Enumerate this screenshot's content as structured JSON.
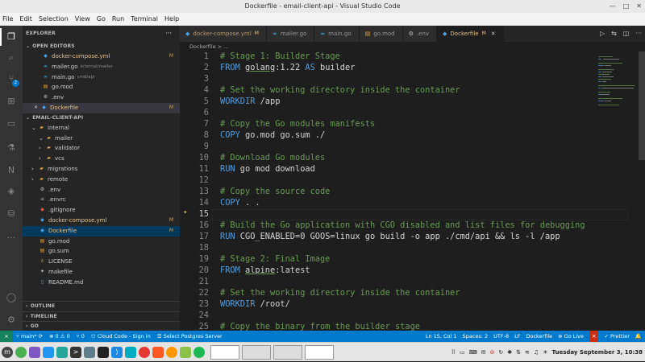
{
  "window": {
    "title": "Dockerfile - email-client-api - Visual Studio Code"
  },
  "menu": [
    "File",
    "Edit",
    "Selection",
    "View",
    "Go",
    "Run",
    "Terminal",
    "Help"
  ],
  "activity": {
    "icons": [
      "files-icon",
      "search-icon",
      "source-control-icon",
      "extensions-icon",
      "remote-explorer-icon",
      "testing-icon",
      "notes-icon",
      "docker-icon",
      "database-icon",
      "more-icon",
      "account-icon",
      "settings-icon"
    ],
    "scm_badge": "2"
  },
  "sidebar": {
    "title": "EXPLORER",
    "more": "···",
    "open_editors_title": "OPEN EDITORS",
    "open_editors": [
      {
        "name": "docker-compose.yml",
        "sub": "",
        "mark": "M",
        "icon": "whale-icon"
      },
      {
        "name": "mailer.go",
        "sub": "internal/mailer",
        "mark": "",
        "icon": "go-icon"
      },
      {
        "name": "main.go",
        "sub": "cmd/api",
        "mark": "",
        "icon": "go-icon"
      },
      {
        "name": "go.mod",
        "sub": "",
        "mark": "",
        "icon": "gomod-icon"
      },
      {
        "name": ".env",
        "sub": "",
        "mark": "",
        "icon": "gear-icon"
      },
      {
        "name": "Dockerfile",
        "sub": "",
        "mark": "M",
        "icon": "whale-icon"
      }
    ],
    "project_title": "EMAIL-CLIENT-API",
    "tree": [
      {
        "name": "internal",
        "indent": 1,
        "type": "folder-open"
      },
      {
        "name": "mailer",
        "indent": 2,
        "type": "folder-open"
      },
      {
        "name": "validator",
        "indent": 2,
        "type": "folder"
      },
      {
        "name": "vcs",
        "indent": 2,
        "type": "folder"
      },
      {
        "name": "migrations",
        "indent": 1,
        "type": "folder"
      },
      {
        "name": "remote",
        "indent": 1,
        "type": "folder"
      },
      {
        "name": ".env",
        "indent": 1,
        "type": "env"
      },
      {
        "name": ".envrc",
        "indent": 1,
        "type": "file"
      },
      {
        "name": ".gitignore",
        "indent": 1,
        "type": "git"
      },
      {
        "name": "docker-compose.yml",
        "indent": 1,
        "type": "whale",
        "mark": "M"
      },
      {
        "name": "Dockerfile",
        "indent": 1,
        "type": "whale",
        "mark": "M"
      },
      {
        "name": "go.mod",
        "indent": 1,
        "type": "gomod"
      },
      {
        "name": "go.sum",
        "indent": 1,
        "type": "gomod"
      },
      {
        "name": "LICENSE",
        "indent": 1,
        "type": "license"
      },
      {
        "name": "makefile",
        "indent": 1,
        "type": "make"
      },
      {
        "name": "README.md",
        "indent": 1,
        "type": "md"
      }
    ],
    "outline": "OUTLINE",
    "timeline": "TIMELINE",
    "go": "GO"
  },
  "tabs": [
    {
      "label": "docker-compose.yml",
      "mark": "M",
      "active": false
    },
    {
      "label": "mailer.go",
      "mark": "",
      "active": false
    },
    {
      "label": "main.go",
      "mark": "",
      "active": false
    },
    {
      "label": "go.mod",
      "mark": "",
      "active": false
    },
    {
      "label": ".env",
      "mark": "",
      "active": false
    },
    {
      "label": "Dockerfile",
      "mark": "M",
      "active": true
    }
  ],
  "breadcrumb": "Dockerfile > ...",
  "code": [
    {
      "n": "1",
      "t": [
        [
          "c",
          "# Stage 1: Builder Stage"
        ]
      ]
    },
    {
      "n": "2",
      "t": [
        [
          "k",
          "FROM "
        ],
        [
          "",
          "golang",
          "u"
        ],
        [
          "",
          ":1.22 "
        ],
        [
          "k",
          "AS"
        ],
        [
          "",
          " builder"
        ]
      ]
    },
    {
      "n": "3",
      "t": []
    },
    {
      "n": "4",
      "t": [
        [
          "c",
          "# Set the working directory inside the container"
        ]
      ]
    },
    {
      "n": "5",
      "t": [
        [
          "k",
          "WORKDIR"
        ],
        [
          "",
          " /app"
        ]
      ]
    },
    {
      "n": "6",
      "t": []
    },
    {
      "n": "7",
      "t": [
        [
          "c",
          "# Copy the Go modules manifests"
        ]
      ]
    },
    {
      "n": "8",
      "t": [
        [
          "k",
          "COPY"
        ],
        [
          "",
          " go.mod go.sum ./"
        ]
      ]
    },
    {
      "n": "9",
      "t": []
    },
    {
      "n": "10",
      "t": [
        [
          "c",
          "# Download Go modules"
        ]
      ]
    },
    {
      "n": "11",
      "t": [
        [
          "k",
          "RUN"
        ],
        [
          "",
          " go mod download"
        ]
      ]
    },
    {
      "n": "12",
      "t": []
    },
    {
      "n": "13",
      "t": [
        [
          "c",
          "# Copy the source code"
        ]
      ]
    },
    {
      "n": "14",
      "t": [
        [
          "k",
          "COPY"
        ],
        [
          "",
          " . ."
        ]
      ]
    },
    {
      "n": "15",
      "t": [],
      "cur": true
    },
    {
      "n": "16",
      "t": [
        [
          "c",
          "# Build the Go application with CGO disabled and list files for debugging"
        ]
      ]
    },
    {
      "n": "17",
      "t": [
        [
          "k",
          "RUN"
        ],
        [
          "",
          " CGO_ENABLED=0 GOOS=linux go build -o app ./cmd/api && ls -l /app"
        ]
      ]
    },
    {
      "n": "18",
      "t": []
    },
    {
      "n": "19",
      "t": [
        [
          "c",
          "# Stage 2: Final Image"
        ]
      ]
    },
    {
      "n": "20",
      "t": [
        [
          "k",
          "FROM "
        ],
        [
          "",
          "alpine",
          "u"
        ],
        [
          "",
          ":latest"
        ]
      ]
    },
    {
      "n": "21",
      "t": []
    },
    {
      "n": "22",
      "t": [
        [
          "c",
          "# Set the working directory inside the container"
        ]
      ]
    },
    {
      "n": "23",
      "t": [
        [
          "k",
          "WORKDIR"
        ],
        [
          "",
          " /root/"
        ]
      ]
    },
    {
      "n": "24",
      "t": []
    },
    {
      "n": "25",
      "t": [
        [
          "c",
          "# Copy the binary from the builder stage"
        ]
      ]
    }
  ],
  "status": {
    "branch": "main*",
    "sync": "⟳",
    "problems": "⊗ 0 ⚠ 0",
    "ports": "⑂ 0",
    "cloud": "Cloud Code - Sign in",
    "postgres": "Select Postgres Server",
    "position": "Ln 15, Col 1",
    "spaces": "Spaces: 2",
    "encoding": "UTF-8",
    "eol": "LF",
    "lang": "Dockerfile",
    "golive": "Go Live",
    "prettier": "Prettier"
  },
  "taskbar": {
    "clock": "Tuesday September  3, 10:38"
  },
  "colors": {
    "accent": "#007acc",
    "modified": "#e2c08d",
    "keyword": "#569cd6",
    "comment": "#6a9955"
  }
}
